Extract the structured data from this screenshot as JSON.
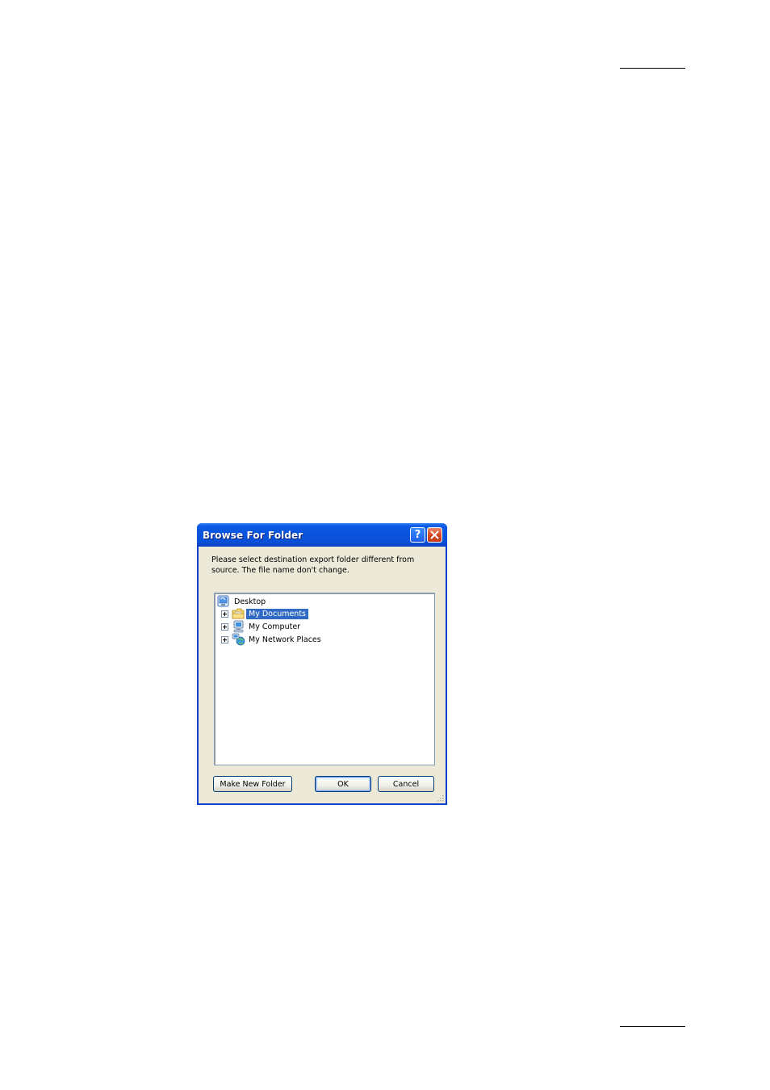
{
  "dialog": {
    "title": "Browse For Folder",
    "help_icon": "help-icon",
    "close_icon": "close-icon",
    "prompt_line1": "Please select destination export folder different from",
    "prompt_line2": "source. The file name don't change.",
    "tree": {
      "root": {
        "label": "Desktop",
        "icon": "desktop-icon"
      },
      "items": [
        {
          "label": "My Documents",
          "icon": "folder-icon",
          "selected": true
        },
        {
          "label": "My Computer",
          "icon": "computer-icon",
          "selected": false
        },
        {
          "label": "My Network Places",
          "icon": "network-places-icon",
          "selected": false
        }
      ]
    },
    "buttons": {
      "make_new_folder": "Make New Folder",
      "ok": "OK",
      "cancel": "Cancel"
    }
  },
  "colors": {
    "titlebar": "#0b54dc",
    "dialog_bg": "#ece9d8",
    "selection": "#316ac5"
  }
}
